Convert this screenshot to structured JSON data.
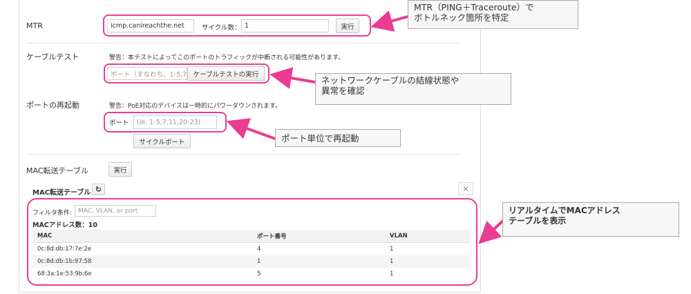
{
  "mtr": {
    "label": "MTR",
    "host_value": "icmp.canireachthe.net",
    "cycles_label": "サイクル数：",
    "cycles_value": "1",
    "run_label": "実行"
  },
  "cable_test": {
    "label": "ケーブルテスト",
    "warning": "警告：本テストによってこのポートのトラフィックが中断される可能性があります。",
    "port_placeholder": "ポート（すなわち、1-5,7",
    "run_label": "ケーブルテストの実行"
  },
  "port_restart": {
    "label": "ポートの再起動",
    "warning": "警告：PoE対応のデバイスは一時的にパワーダウンされます。",
    "port_label": "ポート",
    "port_placeholder": "(ie. 1-5,7,11,20-23)",
    "cycle_label": "サイクルポート"
  },
  "mac_table_row": {
    "label": "MAC転送テーブル",
    "run_label": "実行"
  },
  "mac_panel": {
    "title": "MAC転送テーブル",
    "close_glyph": "×",
    "filter_label": "フィルタ条件:",
    "filter_placeholder": "MAC, VLAN, or port",
    "count_text": "MACアドレス数：10",
    "columns": [
      "MAC",
      "ポート番号",
      "VLAN"
    ],
    "rows": [
      {
        "mac": "0c:8d:db:17:7e:2e",
        "port": "4",
        "vlan": "1"
      },
      {
        "mac": "0c:8d:db:1b:97:58",
        "port": "1",
        "vlan": "1"
      },
      {
        "mac": "68:3a:1e:53:9b:6e",
        "port": "5",
        "vlan": "1"
      }
    ]
  },
  "callouts": {
    "mtr": [
      "MTR（PING＋Traceroute）で",
      "ボトルネック箇所を特定"
    ],
    "cable": [
      "ネットワークケーブルの結線状態や",
      "異常を確認"
    ],
    "port": "ポート単位で再起動",
    "mac": [
      "リアルタイムでMACアドレス",
      "テーブルを表示"
    ]
  },
  "icons": {
    "refresh": "refresh-icon",
    "close": "close-icon"
  },
  "colors": {
    "highlight": "#ea3c91",
    "callout_bg": "#f7f7f7",
    "callout_border": "#a8a8a8"
  }
}
